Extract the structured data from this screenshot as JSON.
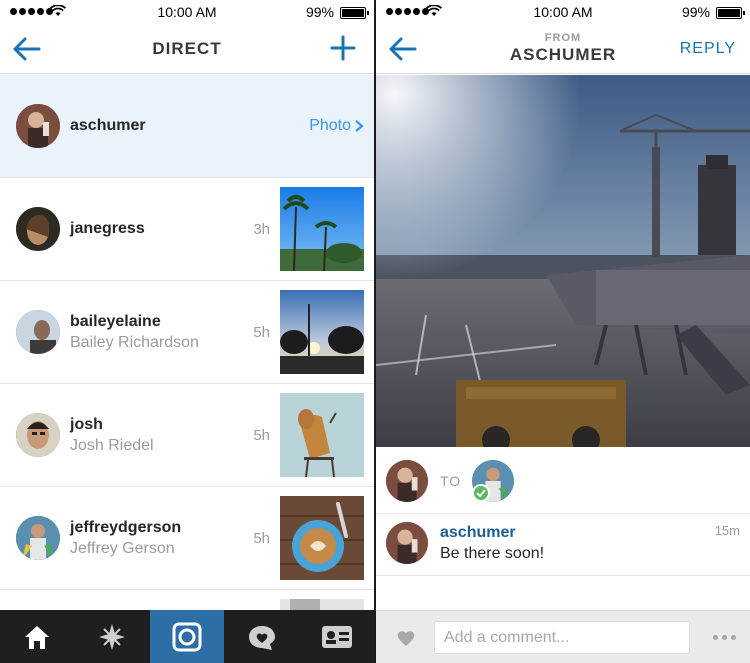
{
  "status_bar": {
    "time": "10:00 AM",
    "battery": "99%"
  },
  "direct": {
    "title": "DIRECT",
    "threads": [
      {
        "username": "aschumer",
        "full_name": "",
        "age": "",
        "action": "Photo"
      },
      {
        "username": "janegress",
        "full_name": "",
        "age": "3h"
      },
      {
        "username": "baileyelaine",
        "full_name": "Bailey Richardson",
        "age": "5h"
      },
      {
        "username": "josh",
        "full_name": "Josh Riedel",
        "age": "5h"
      },
      {
        "username": "jeffreydgerson",
        "full_name": "Jeffrey Gerson",
        "age": "5h"
      }
    ]
  },
  "detail": {
    "from_label": "FROM",
    "from_user": "ASCHUMER",
    "reply_label": "REPLY",
    "to_label": "TO",
    "comment": {
      "username": "aschumer",
      "text": "Be there soon!",
      "age": "15m"
    },
    "composer_placeholder": "Add a comment..."
  },
  "icons": {
    "back": "back-arrow-icon",
    "new": "plus-icon",
    "tabs": [
      "home-icon",
      "explore-icon",
      "camera-icon",
      "activity-icon",
      "profile-icon"
    ]
  },
  "colors": {
    "link_blue": "#3897f0",
    "active_tab": "#2e6ea6",
    "tab_bar": "#1f1f1f"
  }
}
